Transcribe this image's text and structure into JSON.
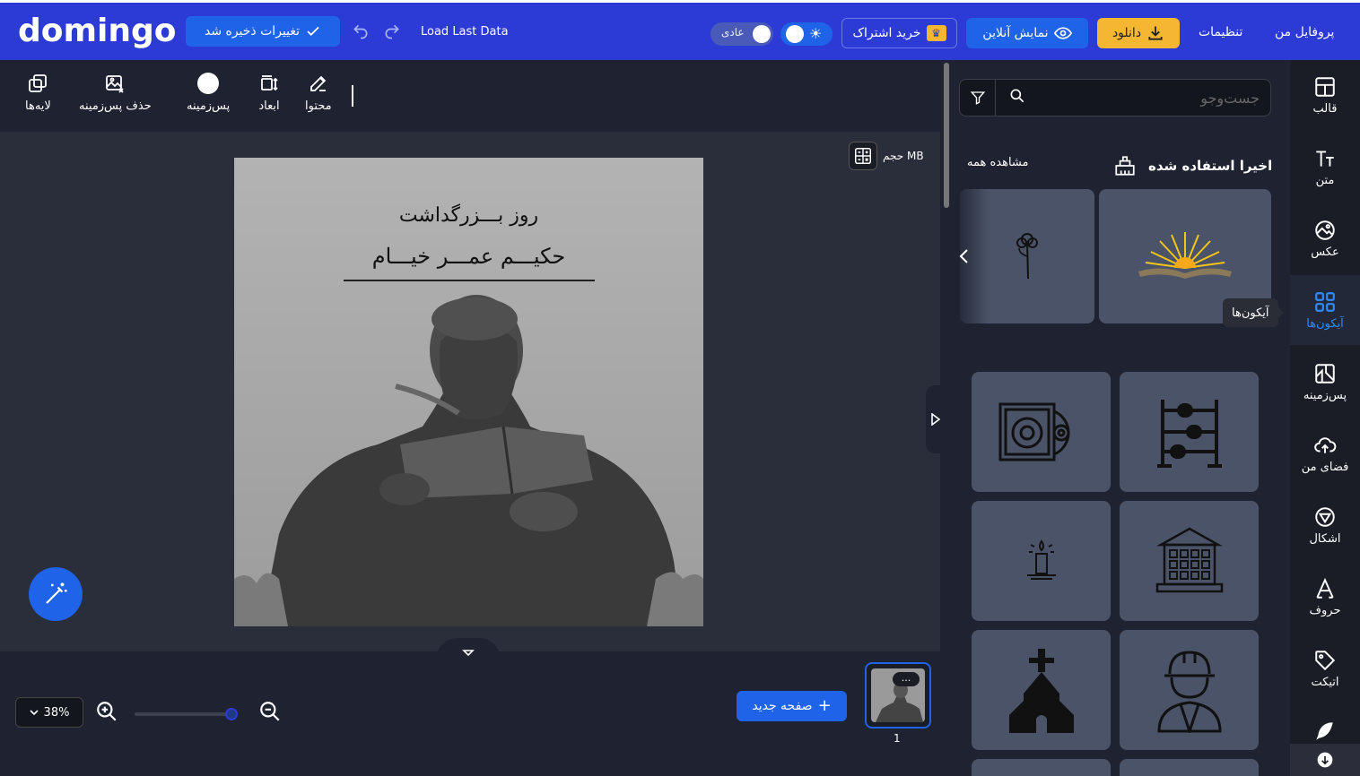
{
  "header": {
    "logo": "domingo",
    "saved_label": "تغییرات ذخیره شد",
    "load_label": "Load Last Data",
    "mode_label": "عادی",
    "subscribe_label": "خرید اشتراک",
    "preview_label": "نمایش آنلاین",
    "download_label": "دانلود",
    "settings_label": "تنظیمات",
    "profile_label": "پروفایل من"
  },
  "toolbar": {
    "content": "محتوا",
    "dimensions": "ابعاد",
    "background": "پس‌زمینه",
    "remove_bg": "حذف پس‌زمینه",
    "layers": "لایه‌ها"
  },
  "canvas": {
    "size_label": "حجم MB",
    "title_line1": "روز بـــزرگداشت",
    "title_line2": "حکیـــم عمـــر خیـــام"
  },
  "bottom": {
    "zoom": "38%",
    "zoom_level": 0.95,
    "new_page": "صفحه جدید",
    "page_number": "1",
    "page_menu": "..."
  },
  "panel": {
    "search_placeholder": "جست‌وجو",
    "recent_title": "اخیرا استفاده شده",
    "see_all": "مشاهده همه",
    "icons": [
      "cassette-tape-icon",
      "abacus-icon",
      "candle-icon",
      "building-icon",
      "church-icon",
      "worker-icon"
    ]
  },
  "sidebar": {
    "items": [
      {
        "label": "قالب",
        "icon": "template-icon"
      },
      {
        "label": "متن",
        "icon": "text-icon"
      },
      {
        "label": "عکس",
        "icon": "photo-icon"
      },
      {
        "label": "آیکون‌ها",
        "icon": "icons-icon",
        "active": true
      },
      {
        "label": "پس‌زمینه",
        "icon": "background-icon"
      },
      {
        "label": "فضای من",
        "icon": "upload-cloud-icon"
      },
      {
        "label": "اشکال",
        "icon": "shapes-icon"
      },
      {
        "label": "حروف",
        "icon": "letters-icon"
      },
      {
        "label": "اتیکت",
        "icon": "tag-icon"
      }
    ],
    "tooltip": "آیکون‌ها"
  },
  "colors": {
    "header_bg": "#2c3bd6",
    "accent": "#1f63e8",
    "download": "#f5b731",
    "panel_bg": "#1f2230",
    "card_bg": "#4a5368",
    "active_text": "#2f8bff"
  }
}
